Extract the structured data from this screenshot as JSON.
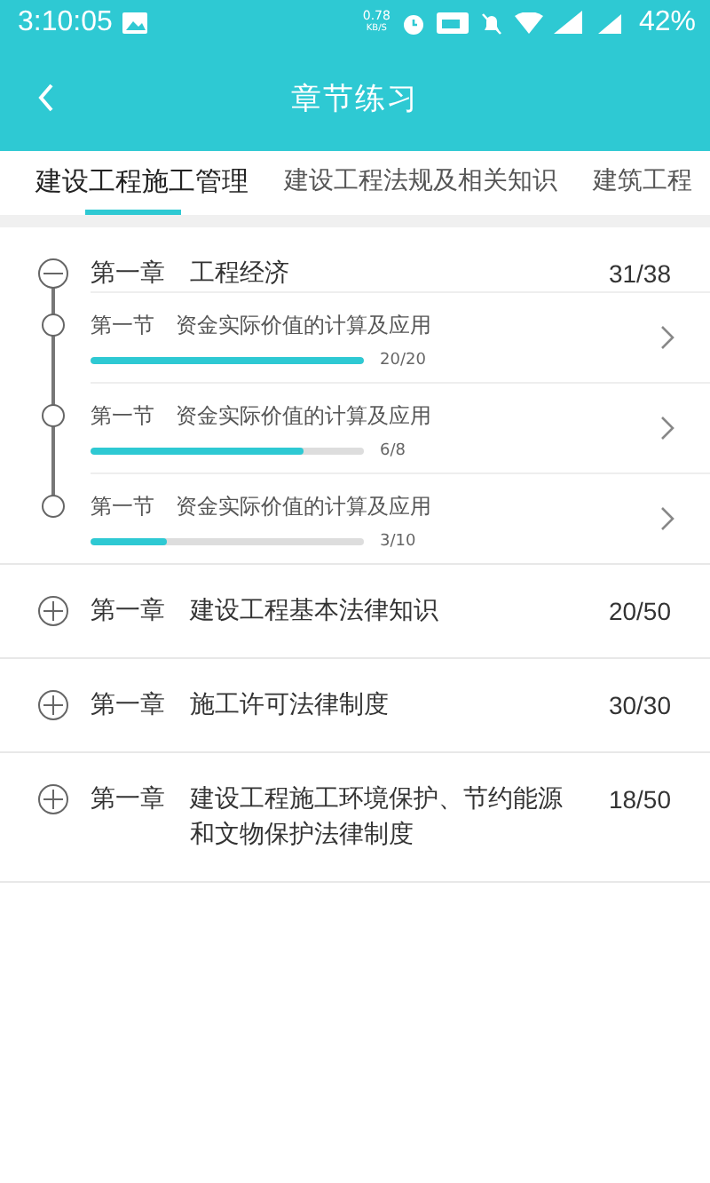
{
  "status_bar": {
    "time": "3:10:05",
    "net_speed": "0.78",
    "net_unit": "KB/S",
    "battery": "42%"
  },
  "header": {
    "title": "章节练习"
  },
  "tabs": [
    {
      "label": "建设工程施工管理",
      "selected": true
    },
    {
      "label": "建设工程法规及相关知识",
      "selected": false
    },
    {
      "label": "建筑工程",
      "selected": false
    }
  ],
  "chapters": [
    {
      "label": "第一章",
      "title": "工程经济",
      "count": "31/38",
      "expanded": true,
      "sections": [
        {
          "label": "第一节",
          "title": "资金实际价值的计算及应用",
          "level": 1,
          "progress": "20/20"
        },
        {
          "label": "第一节",
          "title": "资金实际价值的计算及应用",
          "level": 0.78,
          "progress": "6/8"
        },
        {
          "label": "第一节",
          "title": "资金实际价值的计算及应用",
          "level": 0.28,
          "progress": "3/10"
        }
      ]
    },
    {
      "label": "第一章",
      "title": "建设工程基本法律知识",
      "count": "20/50",
      "expanded": false
    },
    {
      "label": "第一章",
      "title": "施工许可法律制度",
      "count": "30/30",
      "expanded": false
    },
    {
      "label": "第一章",
      "title": "建设工程施工环境保护、节约能源和文物保护法律制度",
      "count": "18/50",
      "expanded": false
    }
  ]
}
